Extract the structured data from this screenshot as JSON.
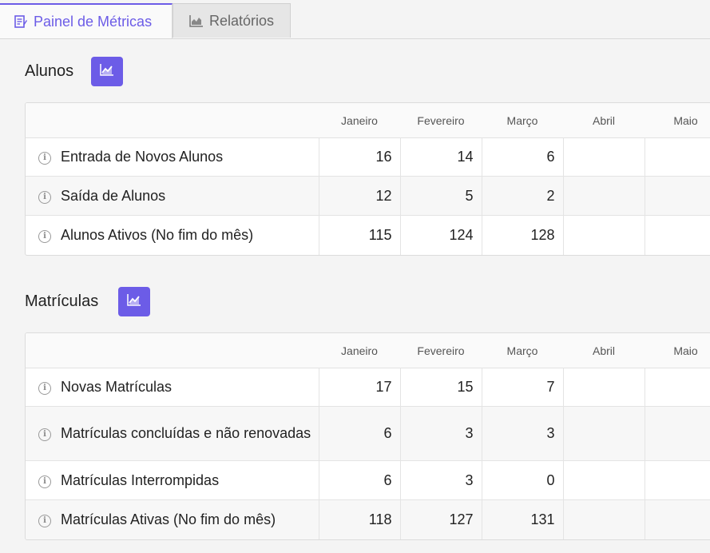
{
  "tabs": [
    {
      "label": "Painel de Métricas",
      "icon": "dashboard-icon",
      "active": true
    },
    {
      "label": "Relatórios",
      "icon": "area-chart-icon",
      "active": false
    }
  ],
  "accent_color": "#6c5ce7",
  "months": [
    "Janeiro",
    "Fevereiro",
    "Março",
    "Abril",
    "Maio"
  ],
  "alunos": {
    "title": "Alunos",
    "chart_button_icon": "line-chart-icon",
    "rows": [
      {
        "label": "Entrada de Novos Alunos",
        "values": [
          "16",
          "14",
          "6",
          "",
          ""
        ]
      },
      {
        "label": "Saída de Alunos",
        "values": [
          "12",
          "5",
          "2",
          "",
          ""
        ]
      },
      {
        "label": "Alunos Ativos (No fim do mês)",
        "values": [
          "115",
          "124",
          "128",
          "",
          ""
        ]
      }
    ]
  },
  "matriculas": {
    "title": "Matrículas",
    "chart_button_icon": "line-chart-icon",
    "rows": [
      {
        "label": "Novas Matrículas",
        "values": [
          "17",
          "15",
          "7",
          "",
          ""
        ]
      },
      {
        "label": "Matrículas concluídas e não renovadas",
        "values": [
          "6",
          "3",
          "3",
          "",
          ""
        ]
      },
      {
        "label": "Matrículas Interrompidas",
        "values": [
          "6",
          "3",
          "0",
          "",
          ""
        ]
      },
      {
        "label": "Matrículas Ativas (No fim do mês)",
        "values": [
          "118",
          "127",
          "131",
          "",
          ""
        ]
      }
    ]
  }
}
